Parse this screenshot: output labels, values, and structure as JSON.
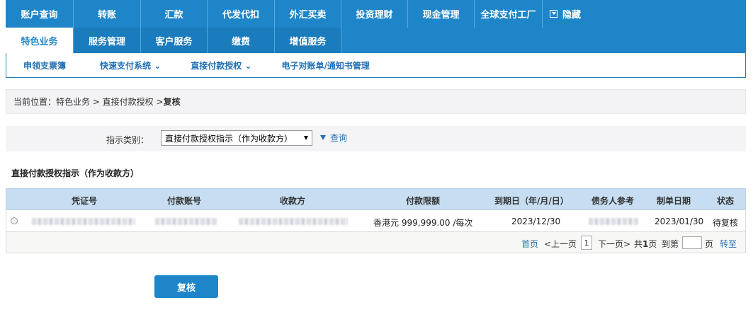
{
  "nav_primary": [
    "账户查询",
    "转账",
    "汇款",
    "代发代扣",
    "外汇买卖",
    "投资理财",
    "现金管理",
    "全球支付工厂"
  ],
  "nav_hide_label": "隐藏",
  "nav_secondary": [
    "特色业务",
    "服务管理",
    "客户服务",
    "缴费",
    "增值服务"
  ],
  "nav_tertiary": [
    "申领支票簿",
    "快速支付系统",
    "直接付款授权",
    "电子对账单/通知书管理"
  ],
  "breadcrumb": {
    "prefix": "当前位置：特色业务 > 直接付款授权 > ",
    "current": "复核"
  },
  "filter": {
    "label": "指示类别：",
    "selected": "直接付款授权指示（作为收款方）",
    "query_label": "查询"
  },
  "section_title": "直接付款授权指示（作为收款方）",
  "table": {
    "headers": [
      "凭证号",
      "付款账号",
      "收款方",
      "付款限额",
      "到期日（年/月/日）",
      "债务人参考",
      "制单日期",
      "状态"
    ],
    "row": {
      "currency": "香港元",
      "amount": "999,999.00",
      "per": "/每次",
      "due_date": "2023/12/30",
      "created": "2023/01/30",
      "status": "待复核"
    }
  },
  "pager": {
    "first": "首页",
    "prev": "<上一页",
    "page": "1",
    "next": "下一页>",
    "total_prefix": "共",
    "total_pages": "1",
    "total_suffix": "页",
    "goto_prefix": "到第",
    "goto_suffix": "页",
    "go": "转至"
  },
  "action_button": "复核",
  "colors": {
    "nav": "#1e86c8",
    "header_row": "#c7def2",
    "amount": "#e01d1d",
    "link": "#1f6fb5"
  }
}
